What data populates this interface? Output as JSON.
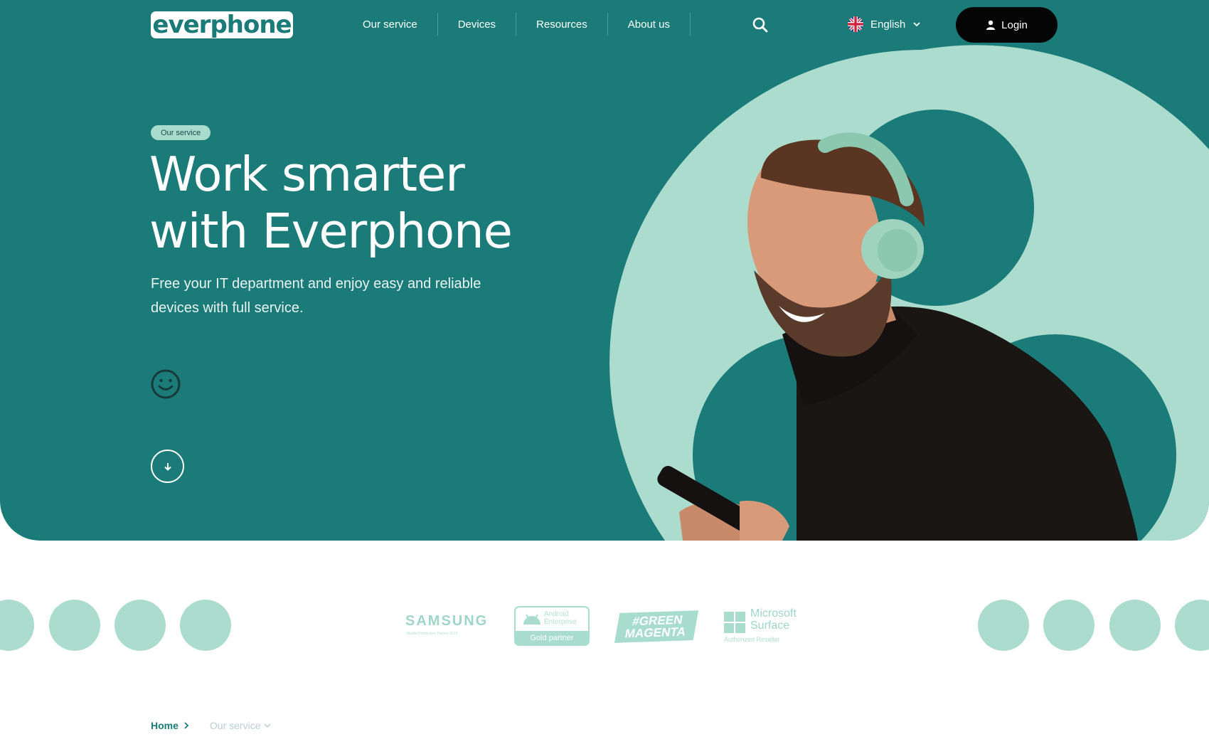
{
  "brand": {
    "logo_text": "everphone",
    "primary_color": "#1b7b78",
    "accent_color": "#a8dccd",
    "login_bg": "#050505"
  },
  "nav": {
    "items": [
      {
        "label": "Our service"
      },
      {
        "label": "Devices"
      },
      {
        "label": "Resources"
      },
      {
        "label": "About us"
      }
    ],
    "search_icon": "search-icon",
    "language": {
      "label": "English",
      "flag_icon": "uk-flag-icon",
      "caret_icon": "chevron-down-icon"
    },
    "login": {
      "label": "Login",
      "icon": "user-icon"
    }
  },
  "hero": {
    "tag": "Our service",
    "headline_line1": "Work smarter",
    "headline_line2": "with Everphone",
    "subtitle_line1": "Free your IT department and enjoy easy and reliable",
    "subtitle_line2": "devices with full service.",
    "smiley_icon": "smiley-icon",
    "scroll_icon": "arrow-down-icon"
  },
  "partners": {
    "samsung": {
      "name": "SAMSUNG",
      "subtitle": "Mobile Distribution Partner 2019"
    },
    "android": {
      "line1": "Android",
      "line2": "Enterprise",
      "badge": "Gold partner"
    },
    "greenmagenta": {
      "line1": "#GREEN",
      "line2": "MAGENTA"
    },
    "microsoft": {
      "line1": "Microsoft",
      "line2": "Surface",
      "subtitle": "Authorized Reseller"
    }
  },
  "breadcrumb": {
    "home": "Home",
    "current": "Our service"
  }
}
